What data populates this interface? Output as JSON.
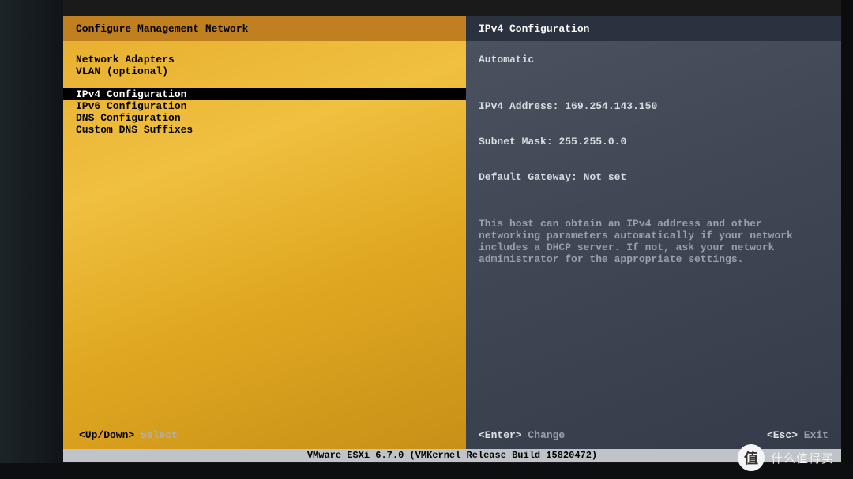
{
  "left": {
    "title": "Configure Management Network",
    "groups": [
      [
        "Network Adapters",
        "VLAN (optional)"
      ],
      [
        "IPv4 Configuration",
        "IPv6 Configuration",
        "DNS Configuration",
        "Custom DNS Suffixes"
      ]
    ],
    "selected": "IPv4 Configuration",
    "hint_keys": "<Up/Down>",
    "hint_action": "Select"
  },
  "right": {
    "title": "IPv4 Configuration",
    "mode": "Automatic",
    "fields": {
      "ipv4_label": "IPv4 Address:",
      "ipv4_value": "169.254.143.150",
      "mask_label": "Subnet Mask:",
      "mask_value": "255.255.0.0",
      "gw_label": "Default Gateway:",
      "gw_value": "Not set"
    },
    "description": "This host can obtain an IPv4 address and other networking parameters automatically if your network includes a DHCP server. If not, ask your network administrator for the appropriate settings.",
    "hint_enter_key": "<Enter>",
    "hint_enter_action": "Change",
    "hint_esc_key": "<Esc>",
    "hint_esc_action": "Exit"
  },
  "statusbar": "VMware ESXi 6.7.0 (VMKernel Release Build 15820472)",
  "watermark": {
    "badge": "值",
    "text": "什么值得买"
  }
}
